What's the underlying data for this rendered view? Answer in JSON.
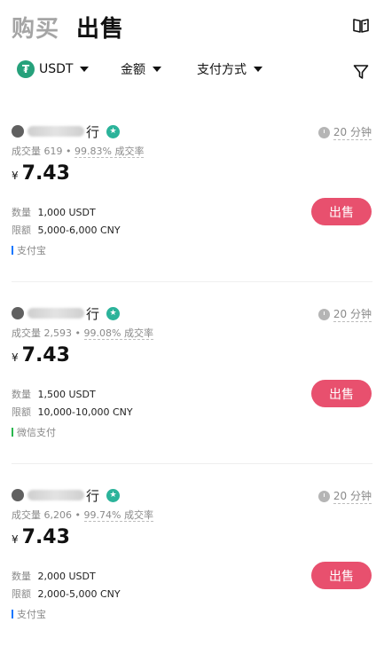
{
  "header": {
    "tab_buy": "购买",
    "tab_sell": "出售",
    "book_icon": "book-icon"
  },
  "filters": {
    "coin_icon_letter": "₮",
    "coin": "USDT",
    "amount": "金额",
    "payment": "支付方式",
    "filter_icon": "funnel-icon"
  },
  "colors": {
    "accent": "#e8506e",
    "verified": "#2bb39a",
    "tether": "#26a17b",
    "alipay": "#1677ff",
    "wechat": "#2ab74e"
  },
  "currency_symbol": "¥",
  "labels": {
    "quantity": "数量",
    "limit": "限额",
    "completion_rate": "成交率"
  },
  "listings": [
    {
      "name_tail": "行",
      "orders_label": "成交量",
      "orders": "619",
      "rate": "99.83%",
      "time": "20 分钟",
      "price": "7.43",
      "quantity": "1,000 USDT",
      "limit": "5,000-6,000 CNY",
      "payment": "支付宝",
      "button": "出售"
    },
    {
      "name_tail": "行",
      "orders_label": "成交量",
      "orders": "2,593",
      "rate": "99.08%",
      "time": "20 分钟",
      "price": "7.43",
      "quantity": "1,500 USDT",
      "limit": "10,000-10,000 CNY",
      "payment": "微信支付",
      "button": "出售"
    },
    {
      "name_tail": "行",
      "orders_label": "成交量",
      "orders": "6,206",
      "rate": "99.74%",
      "time": "20 分钟",
      "price": "7.43",
      "quantity": "2,000 USDT",
      "limit": "2,000-5,000 CNY",
      "payment": "支付宝",
      "button": "出售"
    }
  ]
}
